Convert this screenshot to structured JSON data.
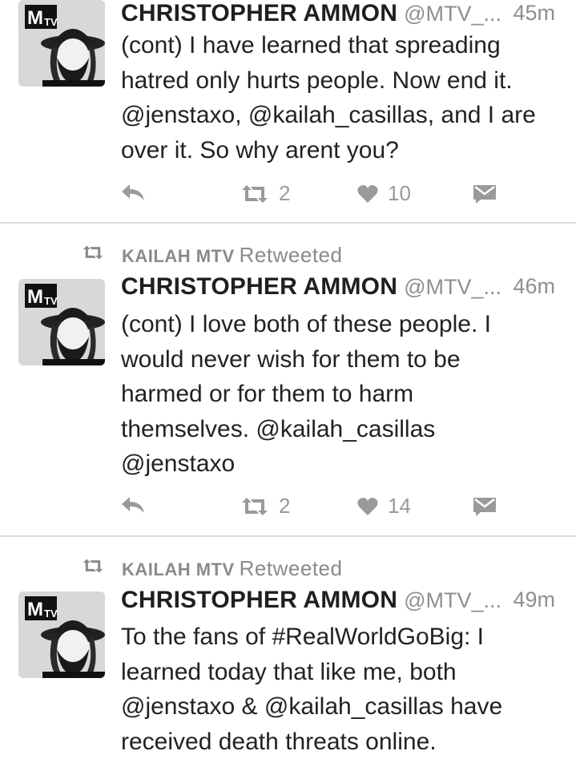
{
  "tweets": [
    {
      "retweeted_by": null,
      "author": "CHRISTOPHER AMMON",
      "handle": "@MTV_...",
      "time": "45m",
      "text": "(cont) I have learned that spreading hatred only hurts people. Now end it. @jenstaxo, @kailah_casillas, and I are over it. So why arent you?",
      "lines": [
        "(cont) I have learned that spreading",
        "hatred only hurts people. Now end it.",
        "@jenstaxo, @kailah_casillas, and I are",
        "over it. So why arent you?"
      ],
      "retweet_count": "2",
      "like_count": "10"
    },
    {
      "retweeted_by": "KAILAH MTV",
      "retweeted_label": "Retweeted",
      "author": "CHRISTOPHER AMMON",
      "handle": "@MTV_...",
      "time": "46m",
      "lines": [
        "(cont) I love both of these people. I",
        "would never wish for them to be",
        "harmed or for them to harm",
        "themselves. @kailah_casillas",
        "@jenstaxo"
      ],
      "retweet_count": "2",
      "like_count": "14"
    },
    {
      "retweeted_by": "KAILAH MTV",
      "retweeted_label": "Retweeted",
      "author": "CHRISTOPHER AMMON",
      "handle": "@MTV_...",
      "time": "49m",
      "lines": [
        "To the fans of #RealWorldGoBig: I",
        "learned today that like me, both",
        "@jenstaxo & @kailah_casillas have",
        "received death threats online."
      ]
    }
  ],
  "icons": {
    "reply": "reply-icon",
    "retweet": "retweet-icon",
    "like": "heart-icon",
    "dm": "direct-message-icon"
  }
}
